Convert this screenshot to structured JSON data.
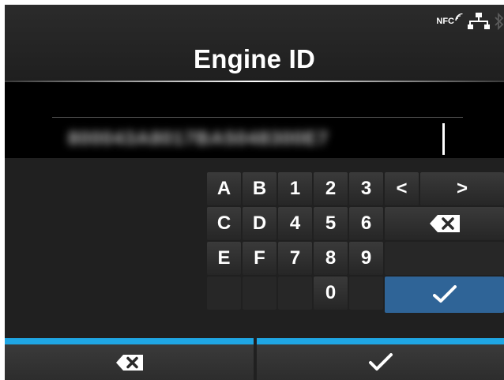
{
  "header": {
    "title": "Engine ID",
    "status_icons": [
      "nfc-icon",
      "network-icon",
      "bluetooth-icon"
    ],
    "nfc_label": "NFC"
  },
  "input": {
    "value": "800043A8017BA5048300E7"
  },
  "keypad": {
    "row1": [
      "A",
      "B",
      "1",
      "2",
      "3",
      "<",
      ">"
    ],
    "row2": [
      "C",
      "D",
      "4",
      "5",
      "6"
    ],
    "row3": [
      "E",
      "F",
      "7",
      "8",
      "9"
    ],
    "row4": [
      "0"
    ],
    "backspace_icon": "backspace-icon",
    "confirm_icon": "checkmark-icon"
  },
  "footer": {
    "left_icon": "backspace-icon",
    "right_icon": "checkmark-icon"
  },
  "colors": {
    "accent_bar": "#1fa6e4",
    "confirm_key": "#2f6497",
    "background": "#202020"
  }
}
